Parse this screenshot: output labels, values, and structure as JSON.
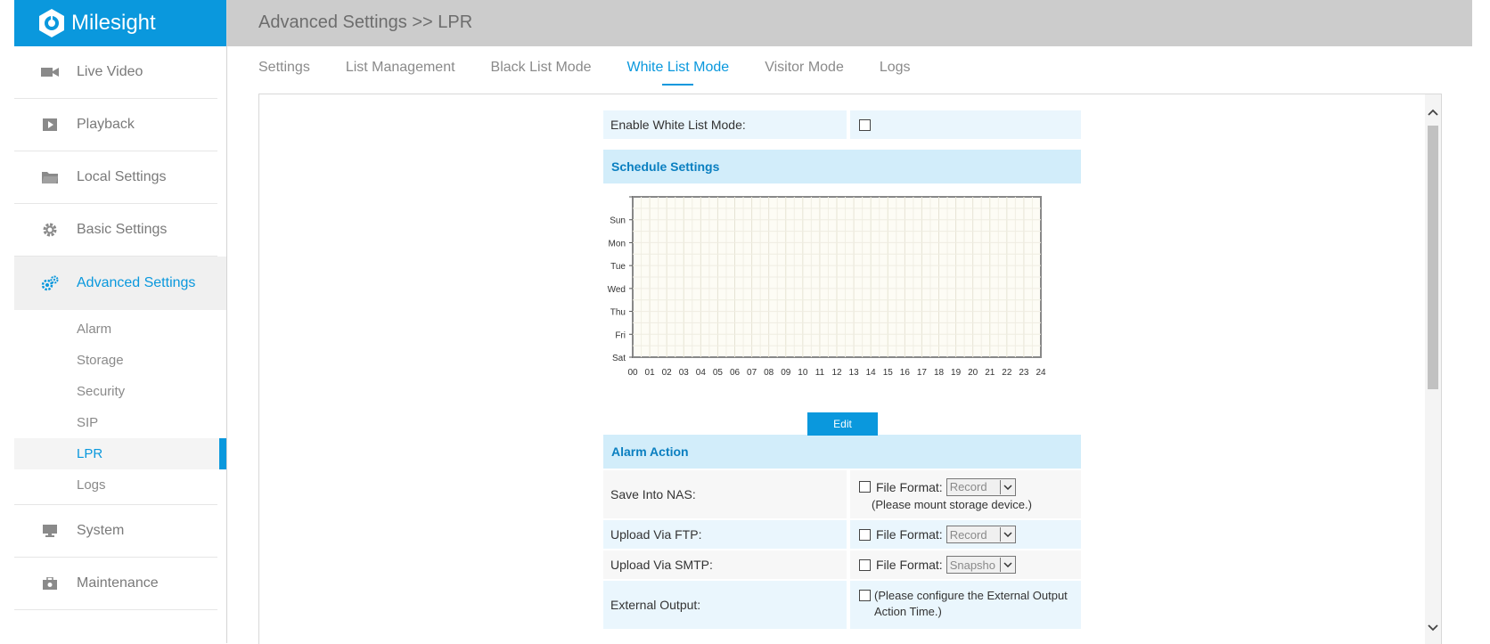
{
  "brand": {
    "name": "Milesight"
  },
  "breadcrumb": "Advanced Settings >> LPR",
  "sidebar": {
    "items": [
      {
        "label": "Live Video",
        "icon": "video-camera-icon"
      },
      {
        "label": "Playback",
        "icon": "play-icon"
      },
      {
        "label": "Local Settings",
        "icon": "folder-icon"
      },
      {
        "label": "Basic Settings",
        "icon": "gear-icon"
      },
      {
        "label": "Advanced Settings",
        "icon": "gears-icon",
        "active": true
      }
    ],
    "subitems": [
      "Alarm",
      "Storage",
      "Security",
      "SIP",
      "LPR",
      "Logs"
    ],
    "active_subitem": "LPR",
    "bottom_items": [
      {
        "label": "System",
        "icon": "monitor-icon"
      },
      {
        "label": "Maintenance",
        "icon": "toolbox-icon"
      }
    ]
  },
  "tabs": [
    "Settings",
    "List Management",
    "Black List Mode",
    "White List Mode",
    "Visitor Mode",
    "Logs"
  ],
  "active_tab": "White List Mode",
  "form": {
    "enable_label": "Enable White List Mode:",
    "schedule_header": "Schedule Settings",
    "days": [
      "Sun",
      "Mon",
      "Tue",
      "Wed",
      "Thu",
      "Fri",
      "Sat"
    ],
    "hours": [
      "00",
      "01",
      "02",
      "03",
      "04",
      "05",
      "06",
      "07",
      "08",
      "09",
      "10",
      "11",
      "12",
      "13",
      "14",
      "15",
      "16",
      "17",
      "18",
      "19",
      "20",
      "21",
      "22",
      "23",
      "24"
    ],
    "edit_label": "Edit",
    "alarm_header": "Alarm Action",
    "nas_label": "Save Into NAS:",
    "ftp_label": "Upload Via FTP:",
    "smtp_label": "Upload Via SMTP:",
    "ext_label": "External Output:",
    "file_format_label": "File Format:",
    "nas_format": "Record",
    "ftp_format": "Record",
    "smtp_format": "Snapsho",
    "nas_note": "(Please mount storage device.)",
    "ext_note": "(Please configure the External Output Action Time.)"
  },
  "colors": {
    "accent": "#0a98dd",
    "topbar": "#cccccc",
    "row_bg": "#eaf6fd",
    "section_bg": "#d2edfa"
  }
}
